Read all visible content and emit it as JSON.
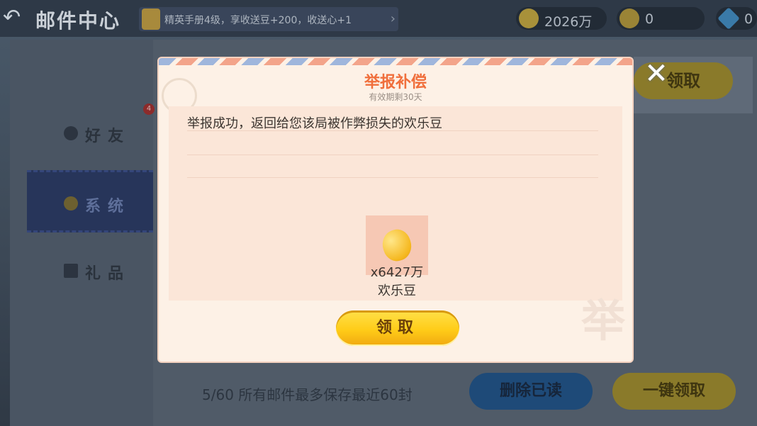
{
  "header": {
    "back_icon": "back-arrow-icon",
    "title": "邮件中心",
    "handbook_text": "精英手册4级，享收送豆+200，收送心+1",
    "currencies": {
      "beans": "2026万",
      "hearts": "0",
      "diamonds": "0"
    }
  },
  "sidebar": {
    "items": [
      {
        "label": "好友",
        "badge": "4"
      },
      {
        "label": "系统"
      },
      {
        "label": "礼品"
      }
    ]
  },
  "background": {
    "claim_label": "领取",
    "bottom_note": "5/60 所有邮件最多保存最近60封",
    "delete_read_label": "删除已读",
    "claim_all_label": "一键领取"
  },
  "dialog": {
    "title": "举报补偿",
    "validity": "有效期剩30天",
    "message": "举报成功，返回给您该局被作弊损失的欢乐豆",
    "reward": {
      "count": "x6427万",
      "name": "欢乐豆",
      "icon": "happy-bean-icon"
    },
    "claim_label": "领取",
    "watermark": "举"
  },
  "colors": {
    "title_accent": "#f06f3c",
    "claim_button": "#ffcc18"
  }
}
